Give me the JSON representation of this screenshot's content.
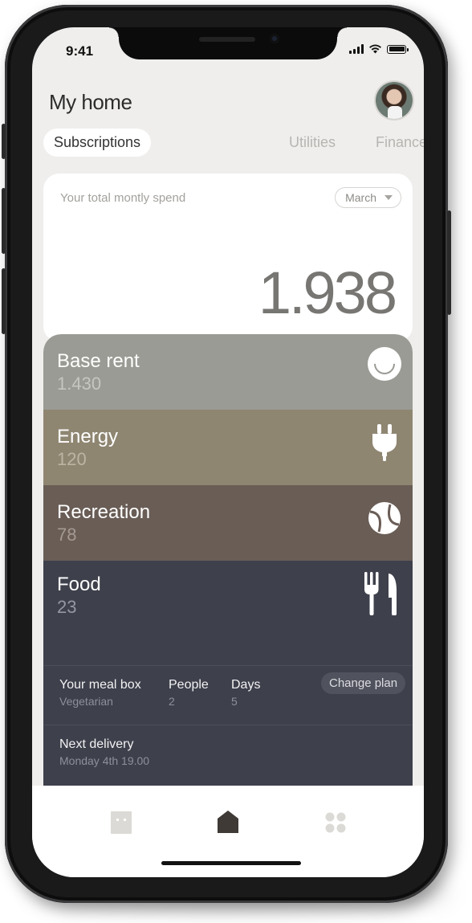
{
  "status_bar": {
    "time": "9:41"
  },
  "header": {
    "title": "My home"
  },
  "tabs": [
    {
      "label": "Subscriptions",
      "active": true
    },
    {
      "label": "Utilities",
      "active": false
    },
    {
      "label": "Finance",
      "active": false
    }
  ],
  "spend_card": {
    "label": "Your total montly spend",
    "month": "March",
    "total": "1.938"
  },
  "categories": [
    {
      "name": "Base rent",
      "amount": "1.430",
      "color": "#9a9b94",
      "icon": "smile-icon"
    },
    {
      "name": "Energy",
      "amount": "120",
      "color": "#8f8672",
      "icon": "plug-icon"
    },
    {
      "name": "Recreation",
      "amount": "78",
      "color": "#695d56",
      "icon": "tennis-ball-icon"
    },
    {
      "name": "Food",
      "amount": "23",
      "color": "#3e404c",
      "icon": "fork-knife-icon"
    }
  ],
  "meal_box": {
    "label": "Your meal box",
    "value": "Vegetarian",
    "people_label": "People",
    "people_value": "2",
    "days_label": "Days",
    "days_value": "5",
    "change_button": "Change plan",
    "next_delivery_label": "Next delivery",
    "next_delivery_value": "Monday 4th 19.00"
  },
  "tab_bar": [
    {
      "icon": "devices-icon",
      "active": false
    },
    {
      "icon": "home-icon",
      "active": true
    },
    {
      "icon": "grid-icon",
      "active": false
    }
  ]
}
